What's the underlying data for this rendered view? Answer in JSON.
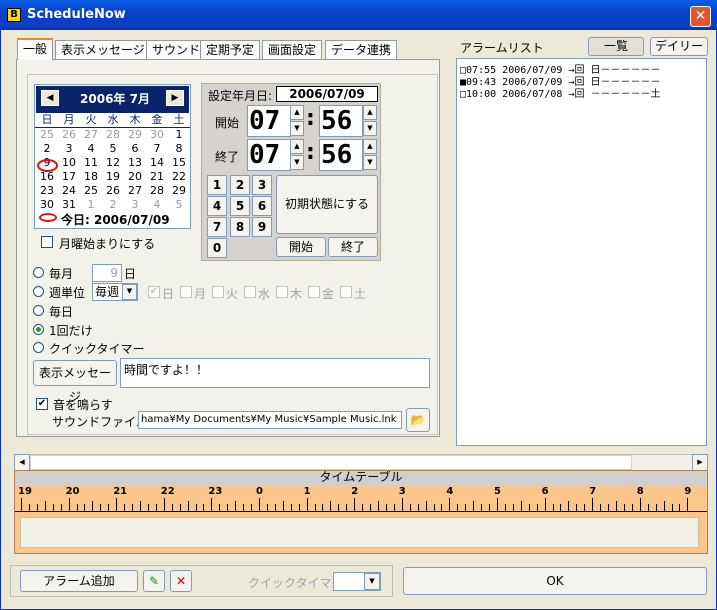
{
  "window": {
    "title": "ScheduleNow",
    "app_icon": "B"
  },
  "tabs": [
    "一般",
    "表示メッセージ",
    "サウンド",
    "定期予定",
    "画面設定",
    "データ連携"
  ],
  "calendar": {
    "title": "2006年 7月",
    "weekdays": [
      "日",
      "月",
      "火",
      "水",
      "木",
      "金",
      "土"
    ],
    "days": [
      [
        "25",
        "26",
        "27",
        "28",
        "29",
        "30",
        "1"
      ],
      [
        "2",
        "3",
        "4",
        "5",
        "6",
        "7",
        "8"
      ],
      [
        "9",
        "10",
        "11",
        "12",
        "13",
        "14",
        "15"
      ],
      [
        "16",
        "17",
        "18",
        "19",
        "20",
        "21",
        "22"
      ],
      [
        "23",
        "24",
        "25",
        "26",
        "27",
        "28",
        "29"
      ],
      [
        "30",
        "31",
        "1",
        "2",
        "3",
        "4",
        "5"
      ]
    ],
    "today_label": "今日: 2006/07/09",
    "monday_start_label": "月曜始まりにする"
  },
  "time_settings": {
    "date_label": "設定年月日:",
    "date_value": "2006/07/09",
    "start_label": "開始",
    "end_label": "終了",
    "start_hour": "07",
    "start_minute": "56",
    "end_hour": "07",
    "end_minute": "56",
    "colon": ":"
  },
  "keypad": {
    "keys": [
      "1",
      "2",
      "3",
      "4",
      "5",
      "6",
      "7",
      "8",
      "9",
      "0"
    ],
    "reset_label": "初期状態にする",
    "start_button": "開始",
    "end_button": "終了"
  },
  "recurrence": {
    "monthly_label": "毎月",
    "monthly_day_value": "9",
    "monthly_day_unit": "日",
    "weekly_label": "週単位",
    "weekly_select": "毎週",
    "weekday_checks": [
      "日",
      "月",
      "火",
      "水",
      "木",
      "金",
      "土"
    ],
    "daily_label": "毎日",
    "once_label": "1回だけ",
    "quick_timer_label": "クイックタイマー"
  },
  "message": {
    "button_label": "表示メッセージ",
    "text": "時間ですよ！！"
  },
  "sound": {
    "play_label": "音を鳴らす",
    "file_label": "サウンドファイル",
    "file_value": "hama¥My Documents¥My Music¥Sample Music.lnk"
  },
  "alarm_list": {
    "title": "アラームリスト",
    "view_list_button": "一覧",
    "view_daily_button": "デイリー",
    "items": [
      {
        "time": "07:55",
        "date": "2006/07/09",
        "arrow": "→",
        "mode": "回",
        "days": "日－－－－－－"
      },
      {
        "time": "09:43",
        "date": "2006/07/09",
        "arrow": "→",
        "mode": "回",
        "days": "日－－－－－－"
      },
      {
        "time": "10:00",
        "date": "2006/07/08",
        "arrow": "→",
        "mode": "回",
        "days": "－－－－－－土"
      }
    ]
  },
  "timetable": {
    "title": "タイムテーブル",
    "hour_labels": [
      "19",
      "20",
      "21",
      "22",
      "23",
      "0",
      "1",
      "2",
      "3",
      "4",
      "5",
      "6",
      "7",
      "8",
      "9"
    ]
  },
  "footer": {
    "add_alarm_button": "アラーム追加",
    "quick_timer_label": "クイックタイマー",
    "quick_timer_value": "",
    "ok_button": "OK"
  },
  "colors": {
    "titlebar": "#0a3fc8",
    "calendar_header": "#0a246a",
    "timetable_bg": "#fbc68a",
    "today_marker": "#e01010"
  }
}
